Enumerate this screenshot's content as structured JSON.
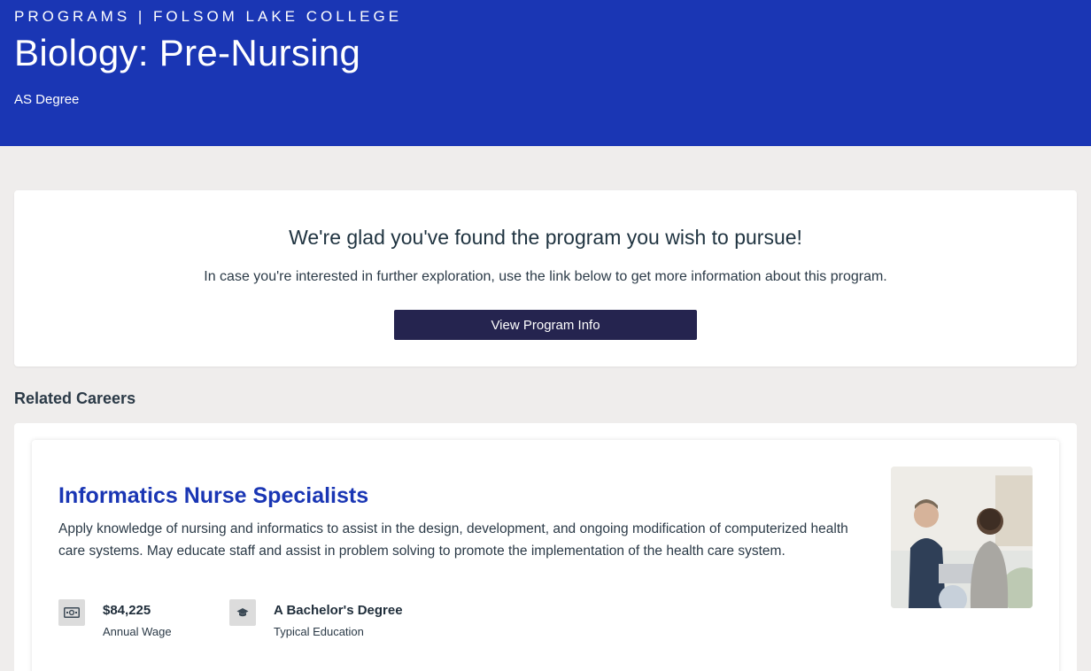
{
  "header": {
    "eyebrow": "PROGRAMS | FOLSOM LAKE COLLEGE",
    "title": "Biology: Pre-Nursing",
    "degree": "AS Degree"
  },
  "info_card": {
    "heading": "We're glad you've found the program you wish to pursue!",
    "text": "In case you're interested in further exploration, use the link below to get more information about this program.",
    "button_label": "View Program Info"
  },
  "related": {
    "section_label": "Related Careers",
    "careers": [
      {
        "title": "Informatics Nurse Specialists",
        "description": "Apply knowledge of nursing and informatics to assist in the design, development, and ongoing modification of computerized health care systems. May educate staff and assist in problem solving to promote the implementation of the health care system.",
        "wage_value": "$84,225",
        "wage_label": "Annual Wage",
        "education_value": "A Bachelor's Degree",
        "education_label": "Typical Education",
        "wage_icon": "money-icon",
        "education_icon": "graduation-cap-icon"
      }
    ]
  },
  "colors": {
    "hero_blue": "#1a36b4",
    "button_navy": "#25244f",
    "page_bg": "#efedec"
  }
}
